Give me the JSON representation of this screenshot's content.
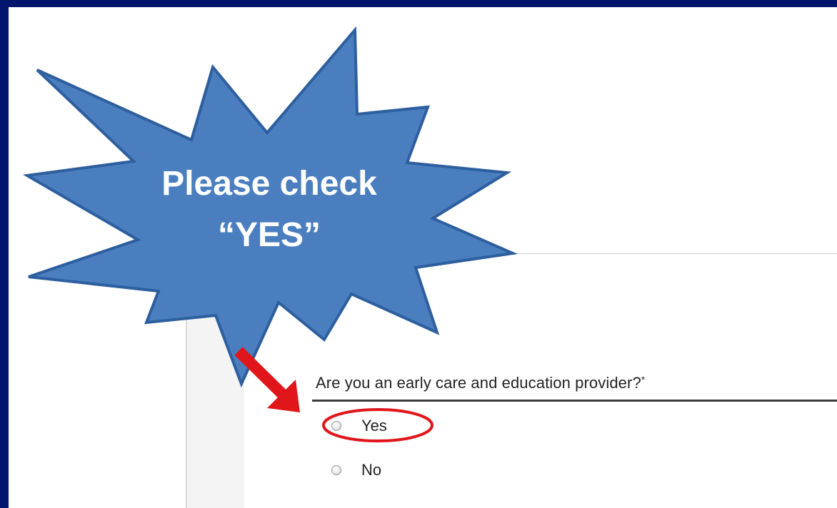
{
  "callout": {
    "line1": "Please check",
    "line2": "“YES”",
    "fill_color": "#4a7ebf",
    "stroke_color": "#2d5f9e"
  },
  "form": {
    "question": "Are you an early care and education provider?",
    "required_marker": "*",
    "options": [
      {
        "label": "Yes",
        "highlighted": true
      },
      {
        "label": "No",
        "highlighted": false
      }
    ]
  },
  "colors": {
    "frame": "#00156b",
    "arrow": "#e0161b",
    "highlight_ring": "#e0161b"
  }
}
